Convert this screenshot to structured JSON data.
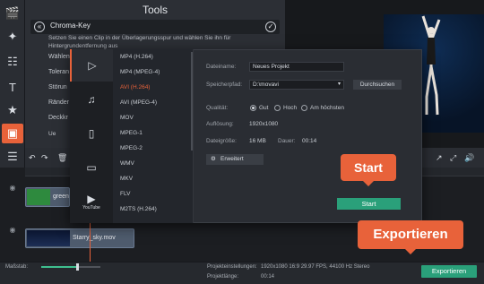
{
  "app": {
    "accent": "#e8623a",
    "green": "#2aa07a"
  },
  "toolbar": {
    "items": [
      {
        "name": "clapper-icon"
      },
      {
        "name": "magic-wand-icon"
      },
      {
        "name": "film-strip-icon"
      },
      {
        "name": "text-icon"
      },
      {
        "name": "star-icon"
      },
      {
        "name": "transition-icon"
      },
      {
        "name": "list-icon"
      }
    ]
  },
  "tools_panel": {
    "title": "Tools",
    "chroma_key": {
      "title": "Chroma-Key",
      "description": "Setzen Sie einen Clip in der Überlagerungsspur und wählen Sie ihn für Hintergrundentfernung aus",
      "labels": [
        "Wählen",
        "Toleran",
        "Störun",
        "Ränder",
        "Deckkr"
      ],
      "button": "Ue"
    }
  },
  "export_dialog": {
    "categories": [
      {
        "name": "video-icon",
        "label": ""
      },
      {
        "name": "music-icon",
        "label": ""
      },
      {
        "name": "device-icon",
        "label": ""
      },
      {
        "name": "tv-icon",
        "label": ""
      },
      {
        "name": "youtube-icon",
        "label": "YouTube"
      }
    ],
    "formats": [
      "MP4 (H.264)",
      "MP4 (MPEG-4)",
      "AVI (H.264)",
      "AVI (MPEG-4)",
      "MOV",
      "MPEG-1",
      "MPEG-2",
      "WMV",
      "MKV",
      "FLV",
      "M2TS (H.264)"
    ],
    "selected_format": "AVI (H.264)",
    "fields": {
      "filename_label": "Dateiname:",
      "filename_value": "Neues Projekt",
      "path_label": "Speicherpfad:",
      "path_value": "D:\\movavi",
      "browse_button": "Durchsuchen",
      "quality_label": "Qualität:",
      "quality_options": [
        "Gut",
        "Hoch",
        "Am höchsten"
      ],
      "quality_selected": "Gut",
      "resolution_label": "Auflösung:",
      "resolution_value": "1920x1080",
      "filesize_label": "Dateigröße:",
      "filesize_value": "16 MB",
      "duration_label": "Dauer:",
      "duration_value": "00:14",
      "advanced_button": "Erweitert",
      "start_button": "Start"
    }
  },
  "timeline": {
    "clips": [
      {
        "name": "green"
      },
      {
        "name": "Starry_sky.mov"
      }
    ]
  },
  "statusbar": {
    "scale_label": "Maßstab:",
    "scale_level": 0.6,
    "project_settings_label": "Projekteinstellungen:",
    "project_settings_value": "1920x1080 16:9 29.97 FPS, 44100 Hz Stereo",
    "project_length_label": "Projektlänge:",
    "project_length_value": "00:14",
    "export_button": "Exportieren"
  },
  "callouts": {
    "start": "Start",
    "export": "Exportieren"
  }
}
